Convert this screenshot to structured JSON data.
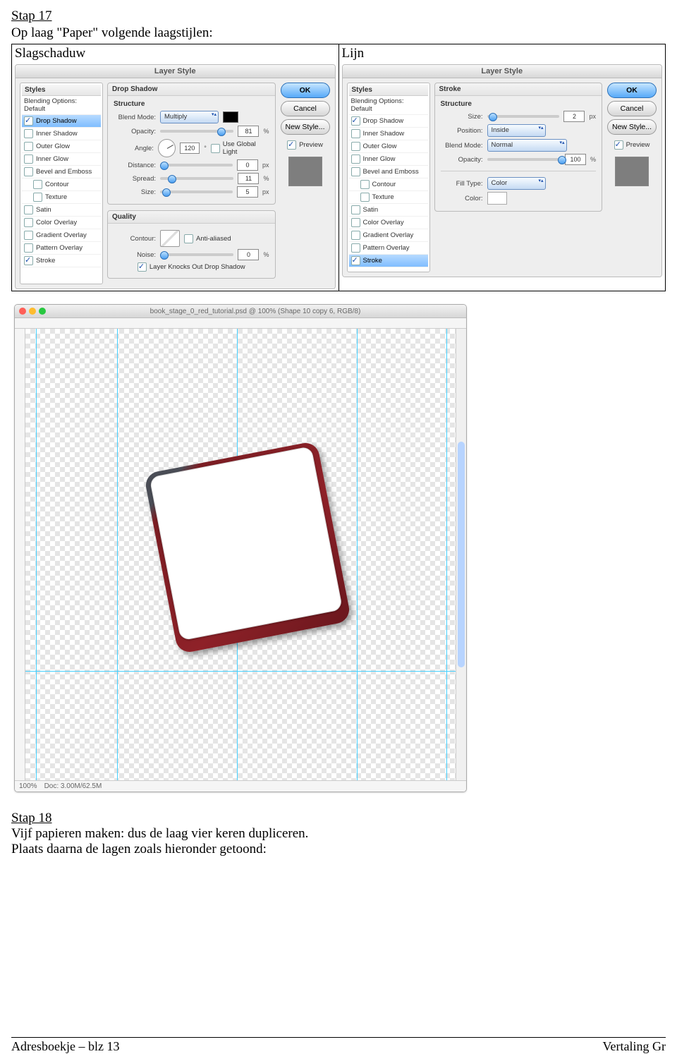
{
  "step17": {
    "title": "Stap 17",
    "desc": "Op laag \"Paper\" volgende laagstijlen:",
    "leftLabel": "Slagschaduw",
    "rightLabel": "Lijn"
  },
  "layerStyle": {
    "title": "Layer Style",
    "stylesHeader": "Styles",
    "blendingDefault": "Blending Options: Default",
    "items": {
      "dropShadow": "Drop Shadow",
      "innerShadow": "Inner Shadow",
      "outerGlow": "Outer Glow",
      "innerGlow": "Inner Glow",
      "bevel": "Bevel and Emboss",
      "contour": "Contour",
      "texture": "Texture",
      "satin": "Satin",
      "colorOverlay": "Color Overlay",
      "gradientOverlay": "Gradient Overlay",
      "patternOverlay": "Pattern Overlay",
      "stroke": "Stroke"
    },
    "buttons": {
      "ok": "OK",
      "cancel": "Cancel",
      "newStyle": "New Style...",
      "preview": "Preview"
    }
  },
  "dropShadow": {
    "sectionTitle": "Drop Shadow",
    "structure": "Structure",
    "blendModeLabel": "Blend Mode:",
    "blendMode": "Multiply",
    "opacityLabel": "Opacity:",
    "opacity": "81",
    "pct": "%",
    "angleLabel": "Angle:",
    "angle": "120",
    "deg": "°",
    "useGlobal": "Use Global Light",
    "distanceLabel": "Distance:",
    "distance": "0",
    "px": "px",
    "spreadLabel": "Spread:",
    "spread": "11",
    "sizeLabel": "Size:",
    "size": "5",
    "quality": "Quality",
    "contourLabel": "Contour:",
    "antiAliased": "Anti-aliased",
    "noiseLabel": "Noise:",
    "noise": "0",
    "knockOut": "Layer Knocks Out Drop Shadow"
  },
  "stroke": {
    "sectionTitle": "Stroke",
    "structure": "Structure",
    "sizeLabel": "Size:",
    "size": "2",
    "px": "px",
    "positionLabel": "Position:",
    "position": "Inside",
    "blendModeLabel": "Blend Mode:",
    "blendMode": "Normal",
    "opacityLabel": "Opacity:",
    "opacity": "100",
    "pct": "%",
    "fillTypeLabel": "Fill Type:",
    "fillType": "Color",
    "colorLabel": "Color:"
  },
  "psWin": {
    "title": "book_stage_0_red_tutorial.psd @ 100% (Shape 10 copy 6, RGB/8)",
    "zoom": "100%",
    "docInfo": "Doc: 3.00M/62.5M"
  },
  "step18": {
    "title": "Stap 18",
    "line1": "Vijf papieren maken: dus de laag vier keren dupliceren.",
    "line2": "Plaats daarna de lagen zoals hieronder getoond:"
  },
  "footer": {
    "left": "Adresboekje – blz 13",
    "right": "Vertaling Gr"
  }
}
